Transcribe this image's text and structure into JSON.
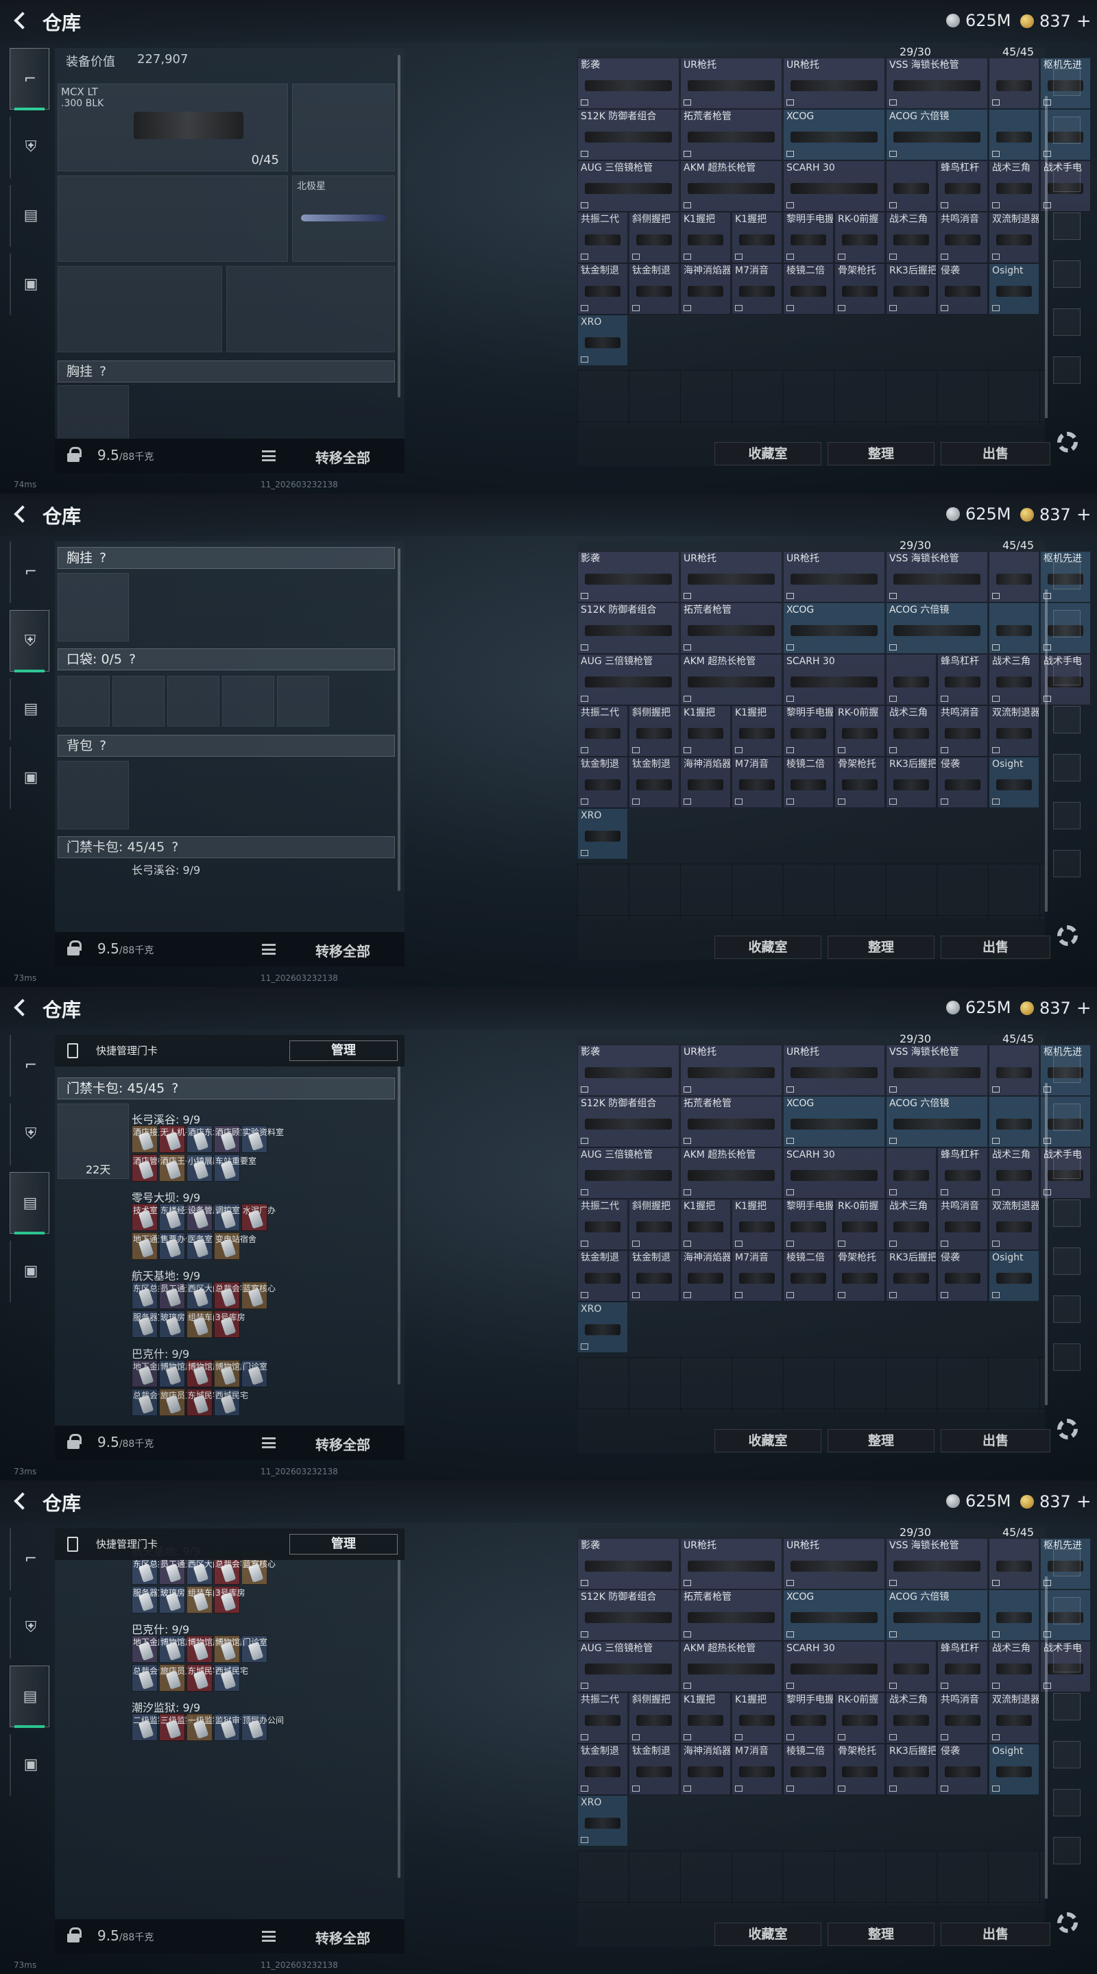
{
  "title": "仓库",
  "currency": {
    "silver": "625M",
    "gold": "837",
    "gold_plus": "+"
  },
  "left": {
    "equip_value_label": "装备价值",
    "equip_value": "227,907",
    "weapon_name": "MCX LT",
    "weapon_ammo": ".300 BLK",
    "weapon_count": "0/45",
    "knife_name": "北极星",
    "chest_label": "胸挂",
    "pocket_label": "口袋: 0/5",
    "backpack_label": "背包",
    "card_label": "门禁卡包: 45/45",
    "help": "?",
    "quick_manage": "快捷管理门卡",
    "manage_btn": "管理",
    "days": "22天"
  },
  "bottom": {
    "weight": "9.5",
    "weight_max": "/88千克",
    "move_all": "转移全部"
  },
  "stash_buttons": [
    "收藏室",
    "整理",
    "出售"
  ],
  "stash_head": {
    "count_a": "29/30",
    "count_b": "45/45"
  },
  "stash_rows": [
    [
      "影袭",
      "UR枪托",
      "UR枪托",
      "VSS 海锁长枪管",
      "",
      "枢机先进"
    ],
    [
      "S12K 防御者组合",
      "拓荒者枪管",
      "XCOG",
      "ACOG 六倍镜",
      "",
      ""
    ],
    [
      "AUG 三倍镜枪管",
      "AKM 超热长枪管",
      "SCARH 30",
      "",
      "蜂鸟杠杆",
      "战术三角",
      "战术手电"
    ],
    [
      "共振二代",
      "斜侧握把",
      "K1握把",
      "K1握把",
      "黎明手电握",
      "RK-0前握",
      "战术三角",
      "共鸣消音",
      "双流制退器"
    ],
    [
      "钛金制退",
      "钛金制退",
      "海神消焰器",
      "M7消音",
      "棱镜二倍",
      "骨架枪托",
      "RK3后握把",
      "侵袭",
      "Osight"
    ],
    [
      "XRO"
    ]
  ],
  "key_groups": [
    {
      "label": "长弓溪谷: 9/9",
      "keys": [
        "酒店接王房",
        "无人机平台",
        "酒店东北房",
        "酒店顾家房",
        "实验资料室",
        "酒店管桃房",
        "酒店王子房",
        "小镇展厅",
        "车站重要室"
      ]
    },
    {
      "label": "零号大坝: 9/9",
      "keys": [
        "技术室",
        "东楼经理室",
        "设备管用室",
        "调控室",
        "水泥厂办",
        "地下通道",
        "售票办公室",
        "医务室",
        "变电站宿舍"
      ]
    },
    {
      "label": "航天基地: 9/9",
      "keys": [
        "东区总控",
        "员工通道",
        "西区大门",
        "总裁会客厅",
        "蓝室核心",
        "服务器室",
        "玻璃房",
        "组装车间",
        "3号库房"
      ]
    },
    {
      "label": "巴克什: 9/9",
      "keys": [
        "地下金库",
        "博物馆展",
        "博物馆展",
        "博物馆展",
        "门诊室",
        "总裁会议室",
        "旅店员工",
        "东城民宅",
        "西城民宅"
      ]
    },
    {
      "label": "潮汐监狱: 9/9",
      "keys": [
        "二级监狱",
        "三级监狱",
        "一级监狱",
        "监狱审讯室",
        "顶层办公间"
      ]
    }
  ],
  "footer": {
    "ping1": "74ms",
    "ping2": "73ms",
    "build": "11_202603232138"
  }
}
